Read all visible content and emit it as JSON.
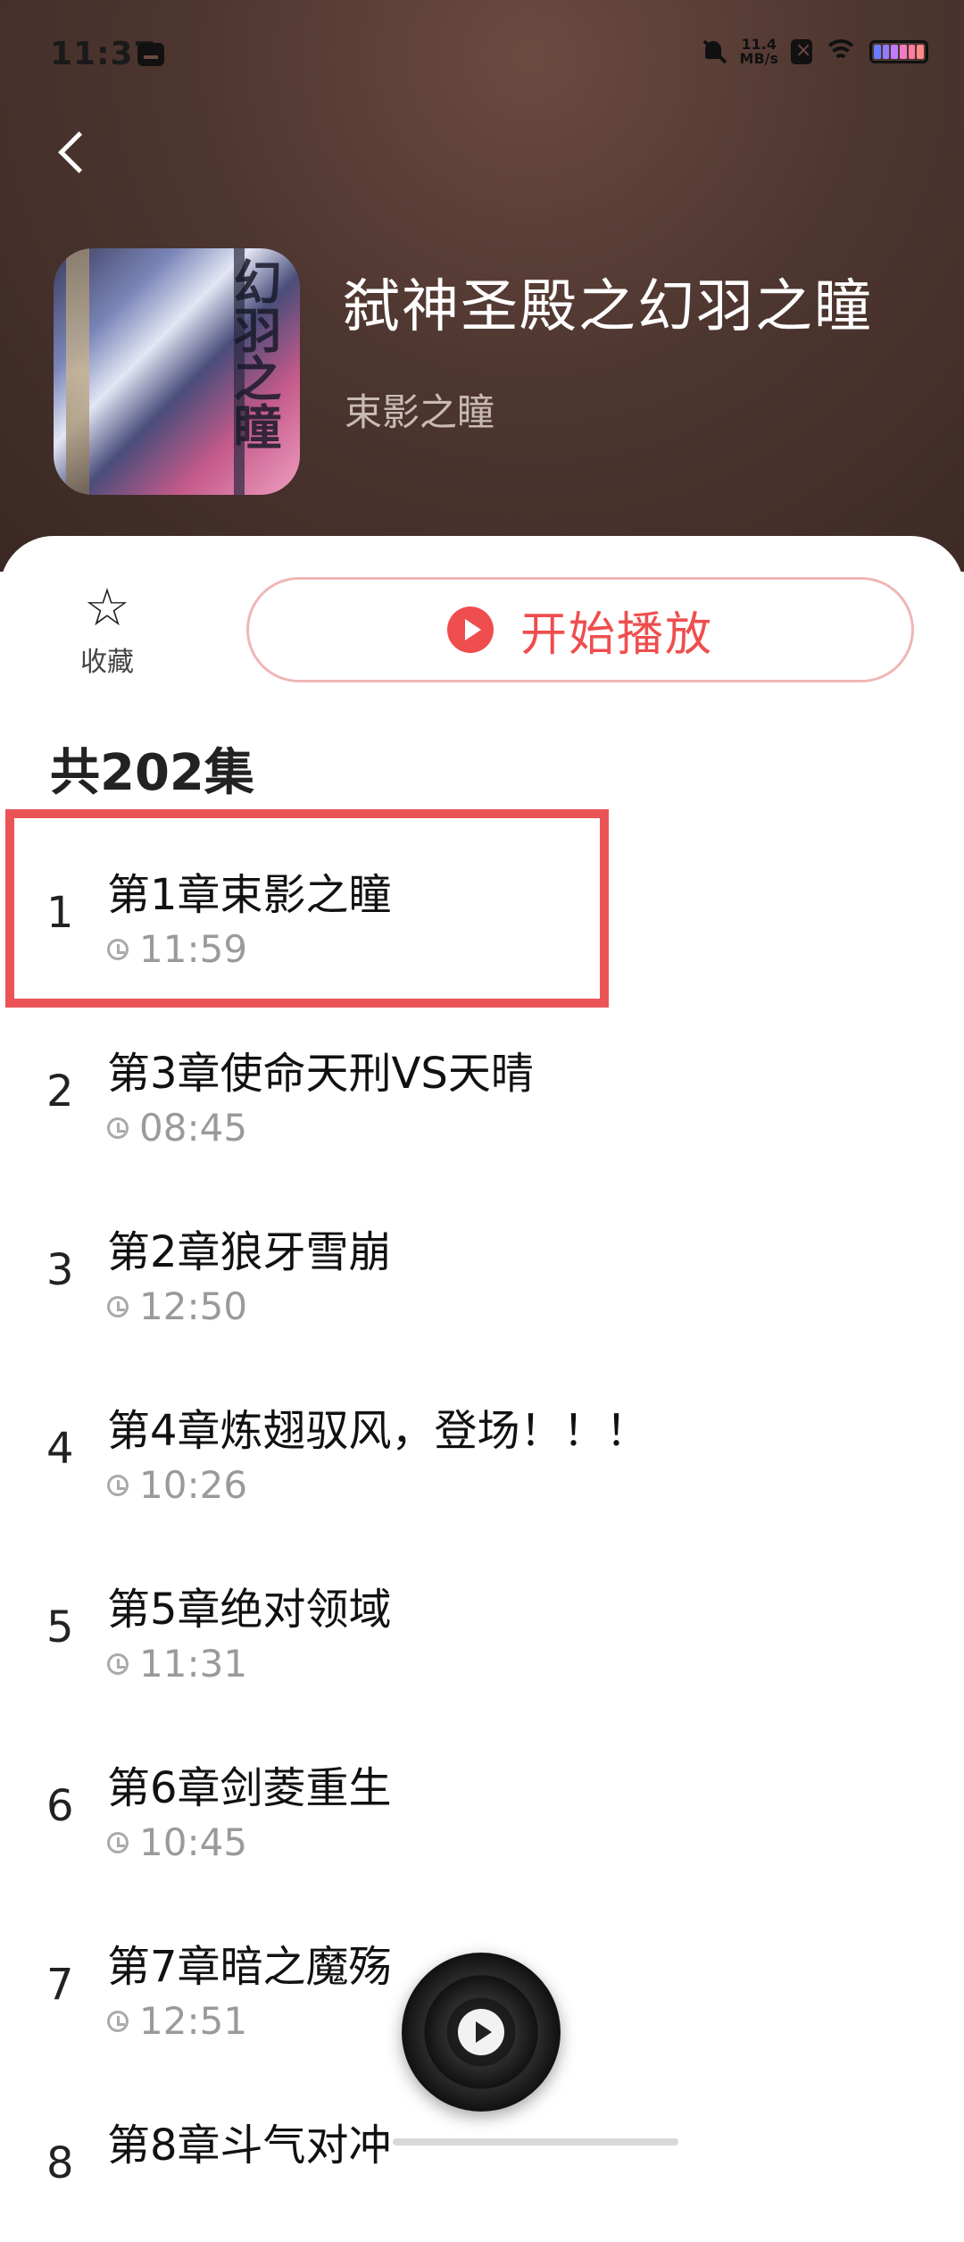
{
  "status_bar": {
    "time": "11:37",
    "net_speed_value": "11.4",
    "net_speed_unit": "MB/s"
  },
  "book": {
    "title": "弑神圣殿之幻羽之瞳",
    "author": "束影之瞳",
    "cover_text": "幻羽之瞳"
  },
  "actions": {
    "favorite_label": "收藏",
    "play_label": "开始播放"
  },
  "episodes_total": "共202集",
  "episodes": [
    {
      "index": "1",
      "title": "第1章束影之瞳",
      "duration": "11:59"
    },
    {
      "index": "2",
      "title": "第3章使命天刑VS天晴",
      "duration": "08:45"
    },
    {
      "index": "3",
      "title": "第2章狼牙雪崩",
      "duration": "12:50"
    },
    {
      "index": "4",
      "title": "第4章炼翅驭风，登场！！！",
      "duration": "10:26"
    },
    {
      "index": "5",
      "title": "第5章绝对领域",
      "duration": "11:31"
    },
    {
      "index": "6",
      "title": "第6章剑菱重生",
      "duration": "10:45"
    },
    {
      "index": "7",
      "title": "第7章暗之魔殇",
      "duration": "12:51"
    },
    {
      "index": "8",
      "title": "第8章斗气对冲",
      "duration": ""
    }
  ],
  "colors": {
    "accent": "#ef4e4e",
    "highlight_border": "#ea5456",
    "hero_background": "#4e3630"
  },
  "icons": {
    "back": "chevron-left-icon",
    "favorite": "star-outline-icon",
    "play": "play-circle-icon",
    "duration": "clock-icon",
    "mini_player": "vinyl-disc-icon"
  }
}
